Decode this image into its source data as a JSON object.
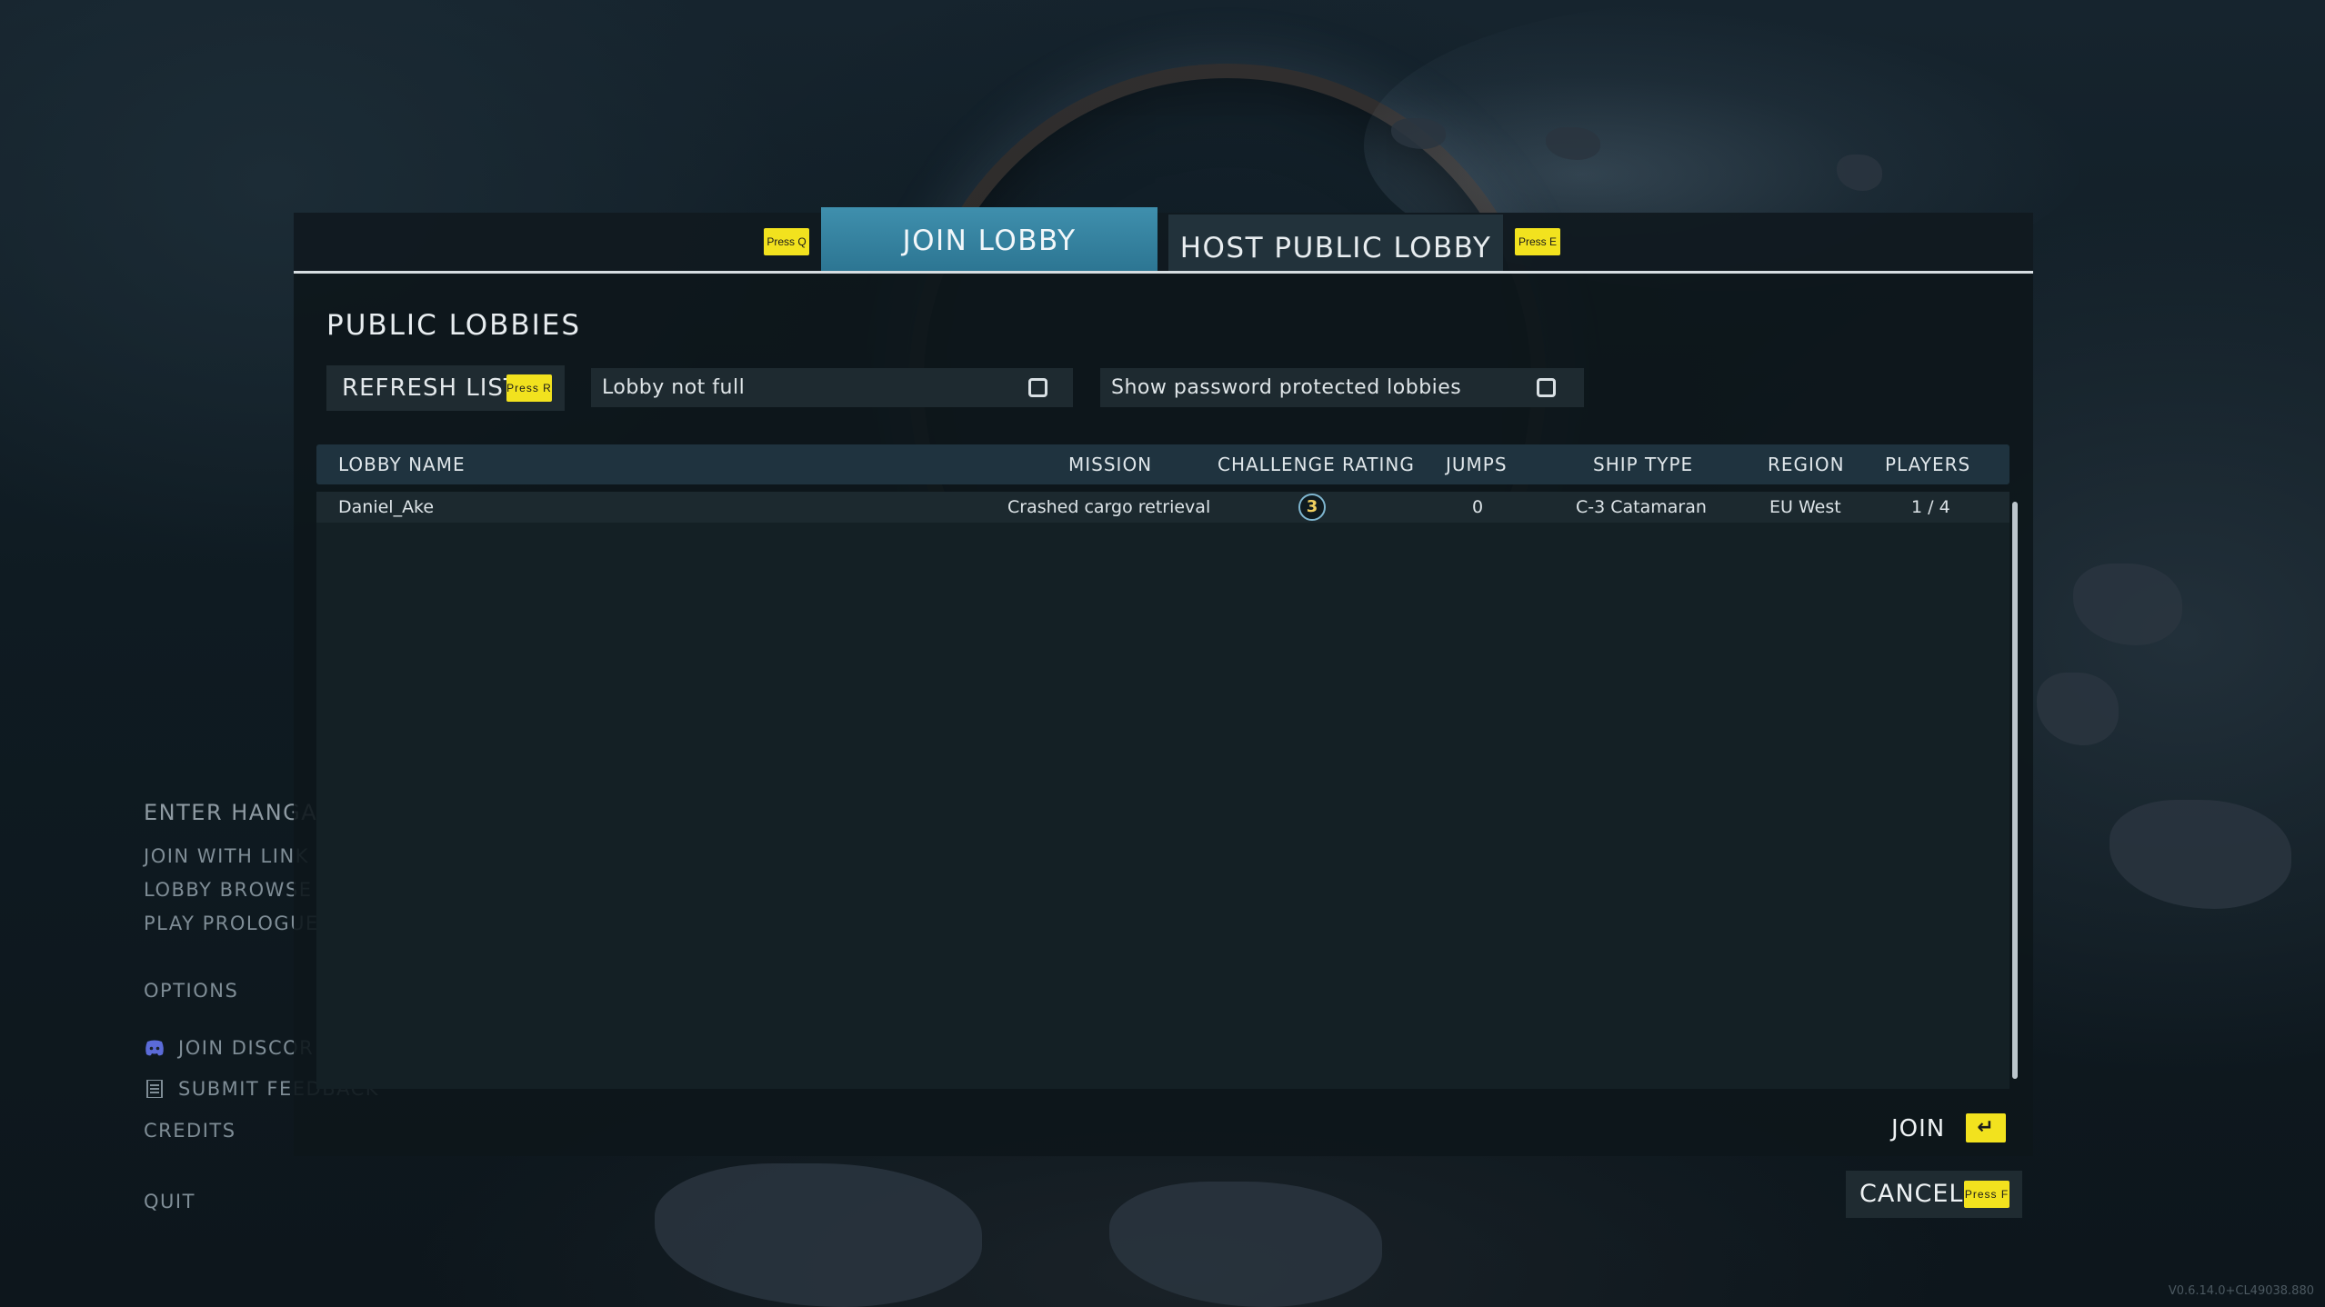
{
  "tabs": {
    "join_label": "JOIN LOBBY",
    "host_label": "HOST PUBLIC LOBBY",
    "prev_hint": "Press Q",
    "next_hint": "Press E"
  },
  "section_title": "PUBLIC LOBBIES",
  "toolbar": {
    "refresh_label": "REFRESH LIST",
    "refresh_hint": "Press R",
    "filter_not_full": "Lobby not full",
    "filter_password": "Show password protected lobbies"
  },
  "table": {
    "headers": {
      "lobby_name": "LOBBY NAME",
      "mission": "MISSION",
      "challenge_rating": "CHALLENGE RATING",
      "jumps": "JUMPS",
      "ship_type": "SHIP TYPE",
      "region": "REGION",
      "players": "PLAYERS"
    },
    "rows": [
      {
        "lobby_name": "Daniel_Ake",
        "mission": "Crashed cargo retrieval",
        "challenge_rating": "3",
        "jumps": "0",
        "ship_type": "C-3 Catamaran",
        "region": "EU West",
        "players": "1 / 4"
      }
    ]
  },
  "footer": {
    "join_label": "JOIN",
    "join_icon": "enter-key-icon",
    "cancel_label": "CANCEL",
    "cancel_hint": "Press F"
  },
  "left_menu": {
    "enter_hangar": "ENTER HANGA",
    "join_with_link": "JOIN WITH LINK",
    "lobby_browser": "LOBBY BROWSE",
    "play_prologue": "PLAY PROLOGUE",
    "options": "OPTIONS",
    "join_discord": "JOIN DISCOR",
    "submit_feedback": "SUBMIT FEEDBACK",
    "credits": "CREDITS",
    "quit": "QUIT"
  },
  "version": "V0.6.14.0+CL49038.880",
  "colors": {
    "accent_tab": "#2c7592",
    "key_hint": "#f2e21e"
  }
}
